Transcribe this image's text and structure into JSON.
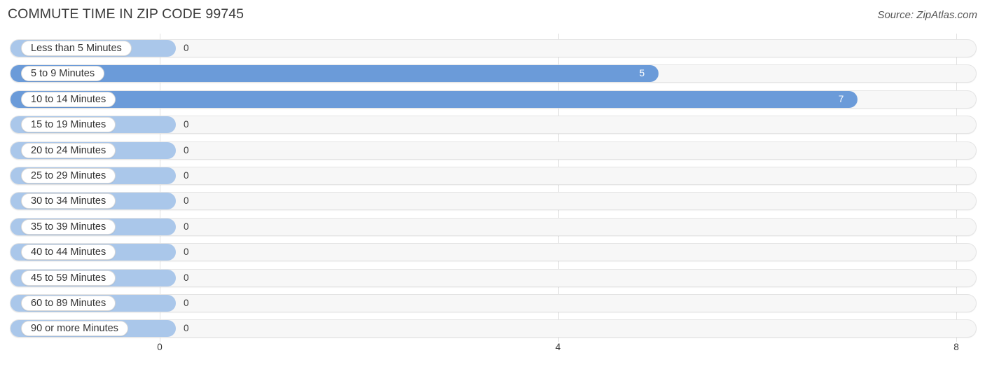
{
  "header": {
    "title": "COMMUTE TIME IN ZIP CODE 99745",
    "source": "Source: ZipAtlas.com"
  },
  "colors": {
    "bar": "#6b9bd9",
    "bar_zero": "#aac7ea",
    "track": "#f7f7f7",
    "gridline": "#e2e2e2",
    "label_text": "#333333",
    "value_text_inside": "#ffffff",
    "value_text_outside": "#3b3b3b"
  },
  "chart_data": {
    "type": "bar",
    "orientation": "horizontal",
    "title": "COMMUTE TIME IN ZIP CODE 99745",
    "xlabel": "",
    "ylabel": "",
    "xlim": [
      0,
      8
    ],
    "ticks": [
      "0",
      "4",
      "8"
    ],
    "tick_values": [
      0,
      4,
      8
    ],
    "grid": true,
    "legend": null,
    "categories": [
      "Less than 5 Minutes",
      "5 to 9 Minutes",
      "10 to 14 Minutes",
      "15 to 19 Minutes",
      "20 to 24 Minutes",
      "25 to 29 Minutes",
      "30 to 34 Minutes",
      "35 to 39 Minutes",
      "40 to 44 Minutes",
      "45 to 59 Minutes",
      "60 to 89 Minutes",
      "90 or more Minutes"
    ],
    "values": [
      0,
      5,
      7,
      0,
      0,
      0,
      0,
      0,
      0,
      0,
      0,
      0
    ],
    "value_labels": [
      "0",
      "5",
      "7",
      "0",
      "0",
      "0",
      "0",
      "0",
      "0",
      "0",
      "0",
      "0"
    ]
  }
}
